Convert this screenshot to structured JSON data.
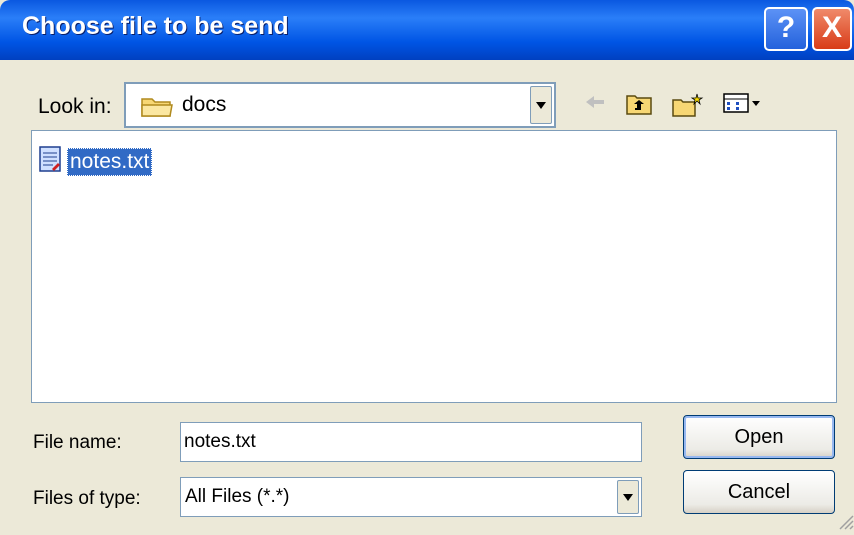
{
  "window": {
    "title": "Choose file to be send",
    "help_icon": "?",
    "close_icon": "X"
  },
  "toolbar": {
    "lookin_label": "Look in:",
    "lookin_value": "docs",
    "icons": [
      "back-arrow-icon",
      "up-folder-icon",
      "new-folder-icon",
      "view-menu-icon"
    ]
  },
  "files": [
    {
      "name": "notes.txt",
      "icon": "text-file-icon",
      "selected": true
    }
  ],
  "form": {
    "filename_label": "File name:",
    "filename_value": "notes.txt",
    "filetype_label": "Files of type:",
    "filetype_value": "All Files (*.*)"
  },
  "buttons": {
    "open_label": "Open",
    "cancel_label": "Cancel"
  },
  "colors": {
    "titlebar": "#0a58e0",
    "selection": "#316ac5",
    "dialog_bg": "#ece9d8"
  }
}
